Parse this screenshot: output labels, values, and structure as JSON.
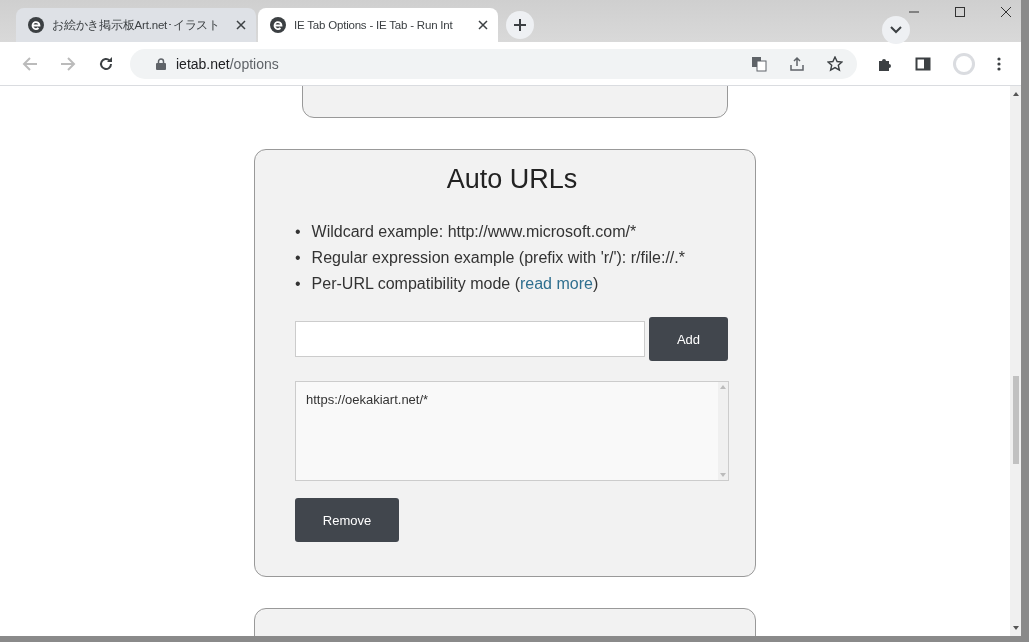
{
  "tabs": [
    {
      "title": "お絵かき掲示板Art.net･イラスト",
      "selected": false
    },
    {
      "title": "IE Tab Options - IE Tab - Run Int",
      "selected": true
    }
  ],
  "address": {
    "host": "ietab.net",
    "path": "/options"
  },
  "auto_urls": {
    "title": "Auto URLs",
    "bullets": [
      {
        "marker": "•",
        "text": "Wildcard example: http://www.microsoft.com/*"
      },
      {
        "marker": "•",
        "text": "Regular expression example (prefix with 'r/'): r/file://.*"
      },
      {
        "marker": "•",
        "text": "Per-URL compatibility mode (",
        "link": "read more",
        "after": ")"
      }
    ],
    "add_button": "Add",
    "list_items": [
      "https://oekakiart.net/*"
    ],
    "remove_button": "Remove"
  }
}
